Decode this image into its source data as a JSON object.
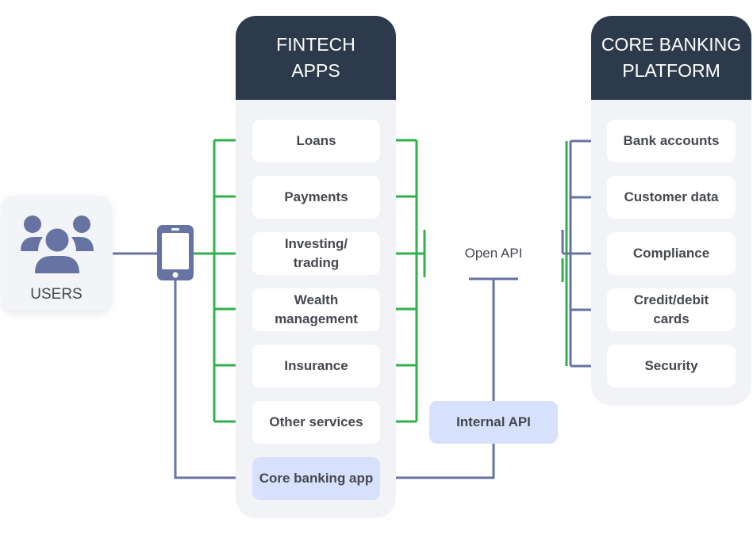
{
  "users": {
    "label": "USERS",
    "icon": "users-icon"
  },
  "phone": {
    "icon": "smartphone-icon"
  },
  "fintech": {
    "title_line1": "FINTECH",
    "title_line2": "APPS",
    "items": [
      {
        "line1": "Loans",
        "line2": ""
      },
      {
        "line1": "Payments",
        "line2": ""
      },
      {
        "line1": "Investing/",
        "line2": "trading"
      },
      {
        "line1": "Wealth",
        "line2": "management"
      },
      {
        "line1": "Insurance",
        "line2": ""
      },
      {
        "line1": "Other services",
        "line2": ""
      }
    ],
    "core_app": "Core banking app"
  },
  "open_api": {
    "label": "Open API"
  },
  "internal_api": {
    "label": "Internal API"
  },
  "core": {
    "title_line1": "CORE BANKING",
    "title_line2": "PLATFORM",
    "items": [
      {
        "line1": "Bank accounts",
        "line2": ""
      },
      {
        "line1": "Customer data",
        "line2": ""
      },
      {
        "line1": "Compliance",
        "line2": ""
      },
      {
        "line1": "Credit/debit",
        "line2": "cards"
      },
      {
        "line1": "Security",
        "line2": ""
      }
    ]
  },
  "colors": {
    "green": "#2fb14b",
    "blue_line": "#6673a3",
    "header": "#2d3a4b",
    "highlight": "#d7e1fb"
  }
}
